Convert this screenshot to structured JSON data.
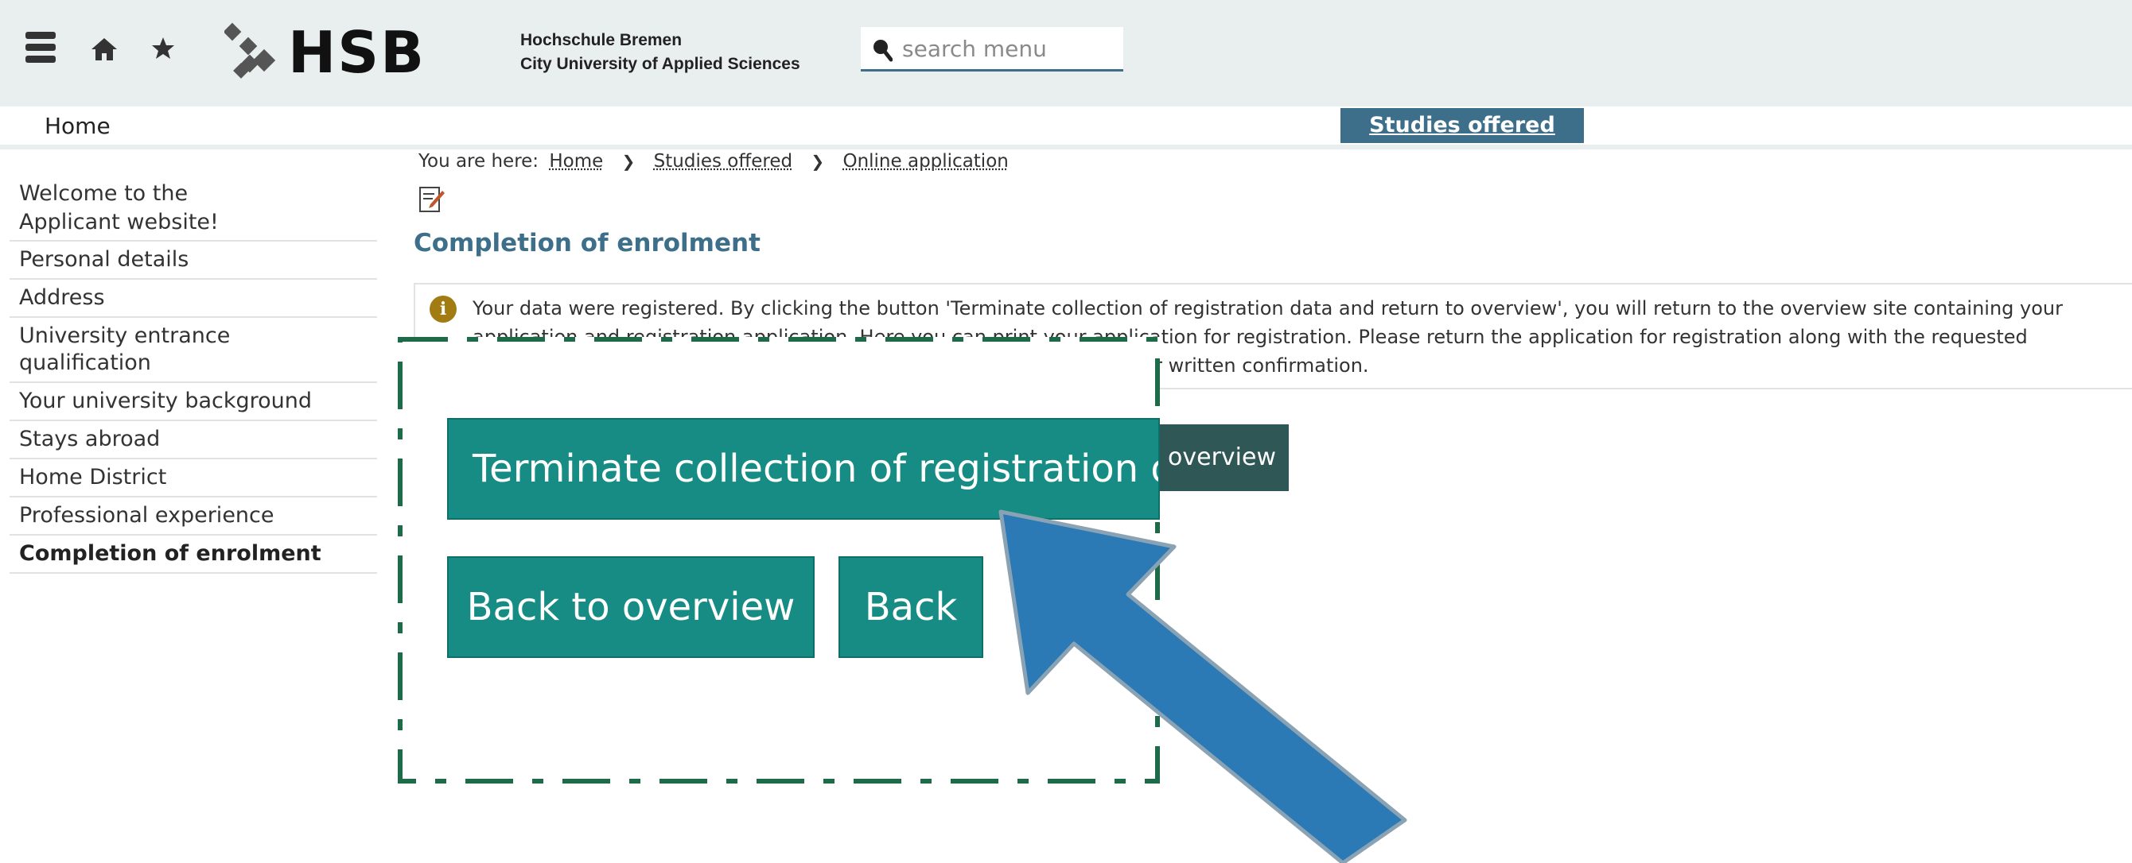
{
  "header": {
    "menu_icon": "hamburger-menu-icon",
    "home_icon": "home-icon",
    "star_icon": "star-icon",
    "logo_text": "HSB",
    "university_line1": "Hochschule Bremen",
    "university_line2": "City University of Applied Sciences",
    "search_placeholder": "search menu"
  },
  "nav": {
    "home": "Home",
    "studies_offered": "Studies offered"
  },
  "sidebar": {
    "items": [
      {
        "label": "Welcome to the Applicant website!"
      },
      {
        "label": "Personal details"
      },
      {
        "label": "Address"
      },
      {
        "label": "University entrance qualification"
      },
      {
        "label": "Your university background"
      },
      {
        "label": "Stays abroad"
      },
      {
        "label": "Home District"
      },
      {
        "label": "Professional experience"
      },
      {
        "label": "Completion of enrolment"
      }
    ]
  },
  "breadcrumb": {
    "prefix": "You are here:",
    "items": [
      "Home",
      "Studies offered",
      "Online application"
    ]
  },
  "main": {
    "title": "Completion of enrolment",
    "info_line1": "Your data were registered. By clicking the button 'Terminate collection of registration data and return to overview', you will return to the overview site containing your",
    "info_line2": "application and registration application. Here you can print your application for registration. Please return the application for registration along with the requested",
    "info_line3": "documents. Your application will be credited by us after we receive your written confirmation.",
    "button_partial": "overview"
  },
  "zoom": {
    "terminate_button": "Terminate collection of registration data and return to overview",
    "back_to_overview_button": "Back to overview",
    "back_button": "Back"
  },
  "colors": {
    "header_bg": "#e9eeee",
    "accent_blue": "#3d6f8a",
    "teal_button": "#168c84",
    "dark_teal_button": "#2e5755",
    "zoom_border": "#1e6b4a",
    "arrow_blue": "#2b79b5"
  }
}
